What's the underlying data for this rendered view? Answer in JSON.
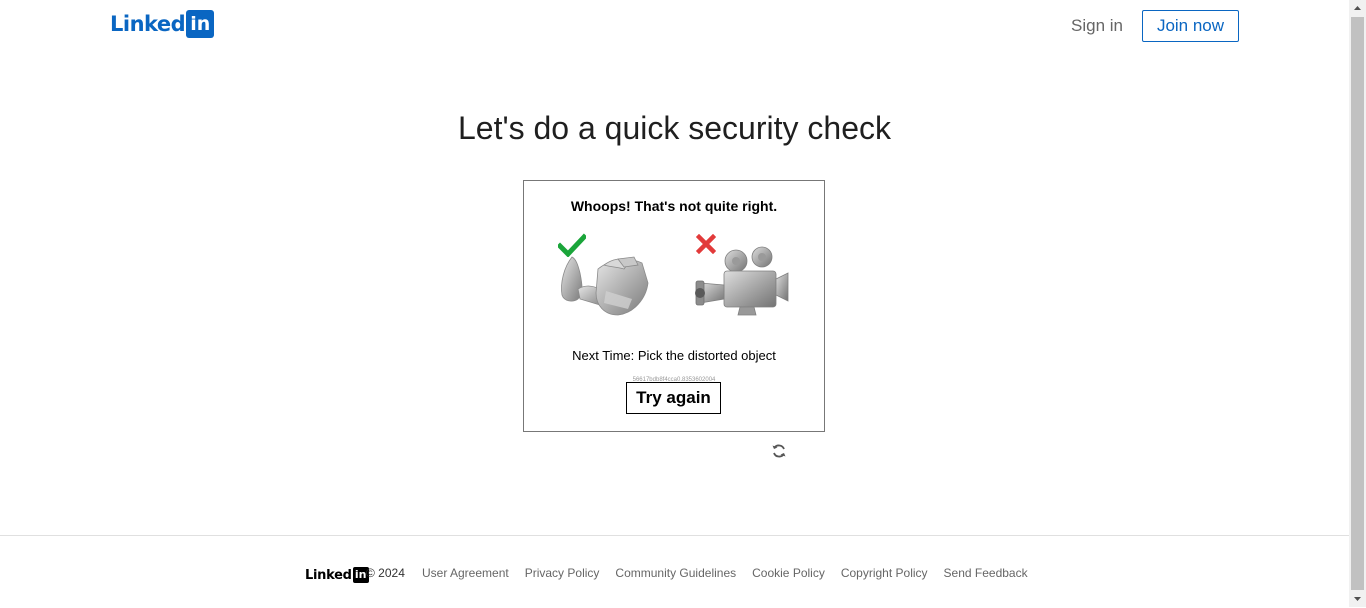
{
  "header": {
    "logo_text": "Linked",
    "logo_box": "in",
    "sign_in": "Sign in",
    "join_now": "Join now"
  },
  "title": "Let's do a quick security check",
  "challenge": {
    "heading": "Whoops! That's not quite right.",
    "next_time": "Next Time: Pick the distorted object",
    "session_id": "56617bdb8f4cca0.8353602004",
    "try_again": "Try again",
    "correct_mark": "check-icon",
    "wrong_mark": "cross-icon"
  },
  "footer": {
    "logo_text": "Linked",
    "logo_box": "in",
    "copyright": "© 2024",
    "links": [
      "User Agreement",
      "Privacy Policy",
      "Community Guidelines",
      "Cookie Policy",
      "Copyright Policy",
      "Send Feedback"
    ]
  },
  "colors": {
    "brand": "#0a66c2",
    "check": "#1aa53a",
    "cross": "#e23a3a"
  }
}
